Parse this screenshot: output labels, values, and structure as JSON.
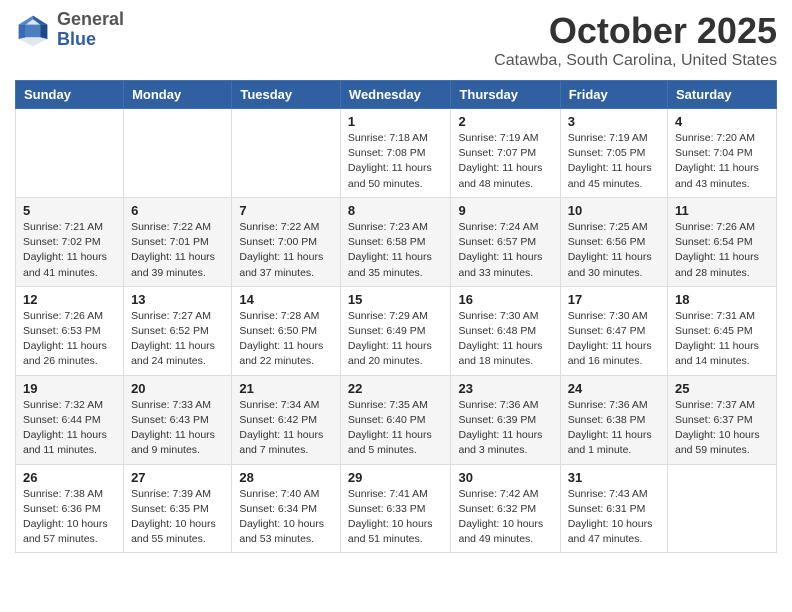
{
  "header": {
    "logo_general": "General",
    "logo_blue": "Blue",
    "month_title": "October 2025",
    "location": "Catawba, South Carolina, United States"
  },
  "calendar": {
    "days_of_week": [
      "Sunday",
      "Monday",
      "Tuesday",
      "Wednesday",
      "Thursday",
      "Friday",
      "Saturday"
    ],
    "weeks": [
      [
        {
          "day": "",
          "info": ""
        },
        {
          "day": "",
          "info": ""
        },
        {
          "day": "",
          "info": ""
        },
        {
          "day": "1",
          "info": "Sunrise: 7:18 AM\nSunset: 7:08 PM\nDaylight: 11 hours\nand 50 minutes."
        },
        {
          "day": "2",
          "info": "Sunrise: 7:19 AM\nSunset: 7:07 PM\nDaylight: 11 hours\nand 48 minutes."
        },
        {
          "day": "3",
          "info": "Sunrise: 7:19 AM\nSunset: 7:05 PM\nDaylight: 11 hours\nand 45 minutes."
        },
        {
          "day": "4",
          "info": "Sunrise: 7:20 AM\nSunset: 7:04 PM\nDaylight: 11 hours\nand 43 minutes."
        }
      ],
      [
        {
          "day": "5",
          "info": "Sunrise: 7:21 AM\nSunset: 7:02 PM\nDaylight: 11 hours\nand 41 minutes."
        },
        {
          "day": "6",
          "info": "Sunrise: 7:22 AM\nSunset: 7:01 PM\nDaylight: 11 hours\nand 39 minutes."
        },
        {
          "day": "7",
          "info": "Sunrise: 7:22 AM\nSunset: 7:00 PM\nDaylight: 11 hours\nand 37 minutes."
        },
        {
          "day": "8",
          "info": "Sunrise: 7:23 AM\nSunset: 6:58 PM\nDaylight: 11 hours\nand 35 minutes."
        },
        {
          "day": "9",
          "info": "Sunrise: 7:24 AM\nSunset: 6:57 PM\nDaylight: 11 hours\nand 33 minutes."
        },
        {
          "day": "10",
          "info": "Sunrise: 7:25 AM\nSunset: 6:56 PM\nDaylight: 11 hours\nand 30 minutes."
        },
        {
          "day": "11",
          "info": "Sunrise: 7:26 AM\nSunset: 6:54 PM\nDaylight: 11 hours\nand 28 minutes."
        }
      ],
      [
        {
          "day": "12",
          "info": "Sunrise: 7:26 AM\nSunset: 6:53 PM\nDaylight: 11 hours\nand 26 minutes."
        },
        {
          "day": "13",
          "info": "Sunrise: 7:27 AM\nSunset: 6:52 PM\nDaylight: 11 hours\nand 24 minutes."
        },
        {
          "day": "14",
          "info": "Sunrise: 7:28 AM\nSunset: 6:50 PM\nDaylight: 11 hours\nand 22 minutes."
        },
        {
          "day": "15",
          "info": "Sunrise: 7:29 AM\nSunset: 6:49 PM\nDaylight: 11 hours\nand 20 minutes."
        },
        {
          "day": "16",
          "info": "Sunrise: 7:30 AM\nSunset: 6:48 PM\nDaylight: 11 hours\nand 18 minutes."
        },
        {
          "day": "17",
          "info": "Sunrise: 7:30 AM\nSunset: 6:47 PM\nDaylight: 11 hours\nand 16 minutes."
        },
        {
          "day": "18",
          "info": "Sunrise: 7:31 AM\nSunset: 6:45 PM\nDaylight: 11 hours\nand 14 minutes."
        }
      ],
      [
        {
          "day": "19",
          "info": "Sunrise: 7:32 AM\nSunset: 6:44 PM\nDaylight: 11 hours\nand 11 minutes."
        },
        {
          "day": "20",
          "info": "Sunrise: 7:33 AM\nSunset: 6:43 PM\nDaylight: 11 hours\nand 9 minutes."
        },
        {
          "day": "21",
          "info": "Sunrise: 7:34 AM\nSunset: 6:42 PM\nDaylight: 11 hours\nand 7 minutes."
        },
        {
          "day": "22",
          "info": "Sunrise: 7:35 AM\nSunset: 6:40 PM\nDaylight: 11 hours\nand 5 minutes."
        },
        {
          "day": "23",
          "info": "Sunrise: 7:36 AM\nSunset: 6:39 PM\nDaylight: 11 hours\nand 3 minutes."
        },
        {
          "day": "24",
          "info": "Sunrise: 7:36 AM\nSunset: 6:38 PM\nDaylight: 11 hours\nand 1 minute."
        },
        {
          "day": "25",
          "info": "Sunrise: 7:37 AM\nSunset: 6:37 PM\nDaylight: 10 hours\nand 59 minutes."
        }
      ],
      [
        {
          "day": "26",
          "info": "Sunrise: 7:38 AM\nSunset: 6:36 PM\nDaylight: 10 hours\nand 57 minutes."
        },
        {
          "day": "27",
          "info": "Sunrise: 7:39 AM\nSunset: 6:35 PM\nDaylight: 10 hours\nand 55 minutes."
        },
        {
          "day": "28",
          "info": "Sunrise: 7:40 AM\nSunset: 6:34 PM\nDaylight: 10 hours\nand 53 minutes."
        },
        {
          "day": "29",
          "info": "Sunrise: 7:41 AM\nSunset: 6:33 PM\nDaylight: 10 hours\nand 51 minutes."
        },
        {
          "day": "30",
          "info": "Sunrise: 7:42 AM\nSunset: 6:32 PM\nDaylight: 10 hours\nand 49 minutes."
        },
        {
          "day": "31",
          "info": "Sunrise: 7:43 AM\nSunset: 6:31 PM\nDaylight: 10 hours\nand 47 minutes."
        },
        {
          "day": "",
          "info": ""
        }
      ]
    ]
  }
}
